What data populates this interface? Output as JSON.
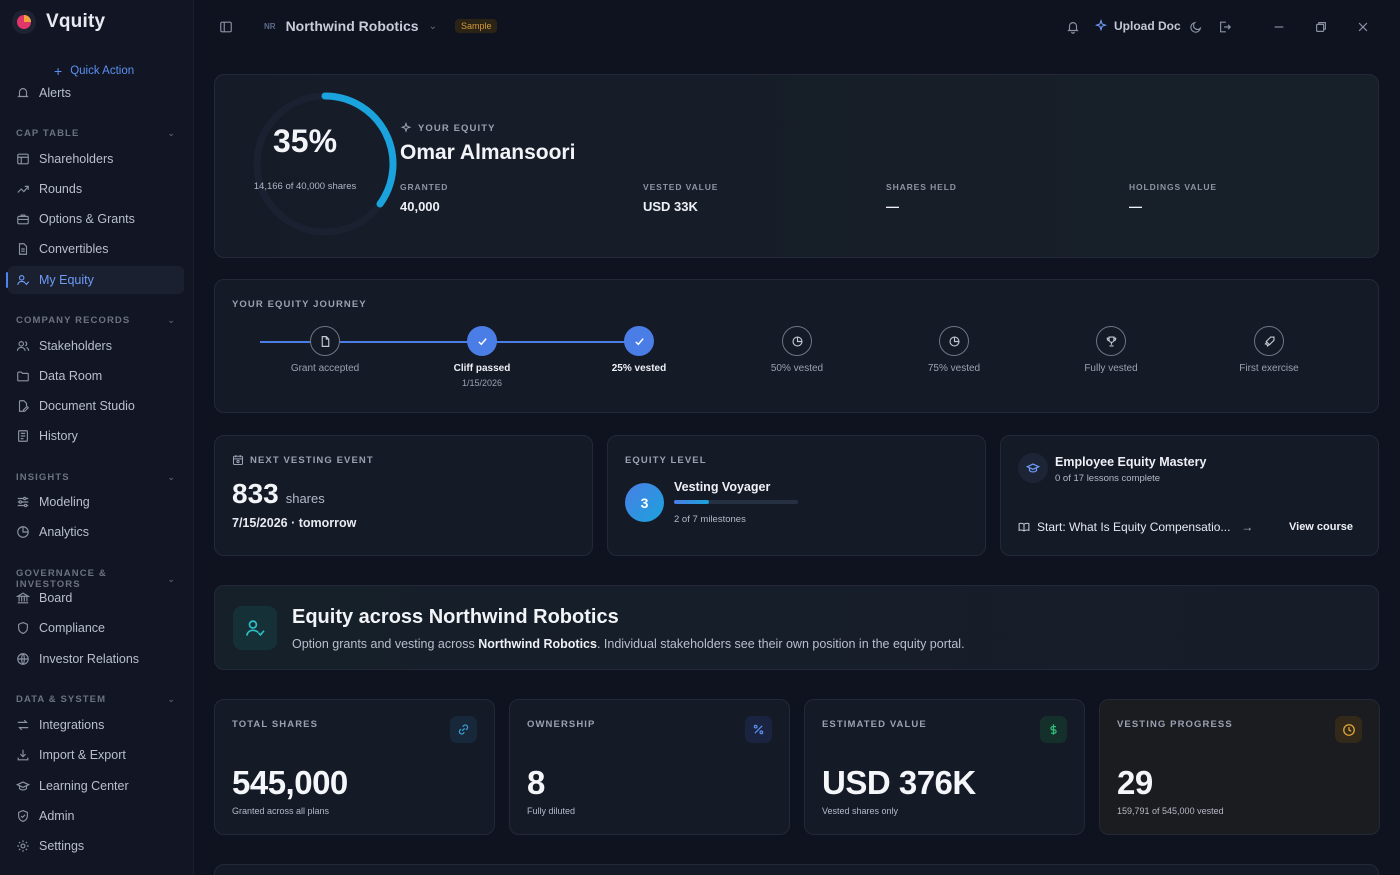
{
  "app": {
    "name": "Vquity",
    "quick_action": "Quick Action",
    "accent": "#4a7ee6"
  },
  "sidebar": {
    "partial_item": "Alerts",
    "sections": [
      {
        "title": "CAP TABLE",
        "items": [
          "Shareholders",
          "Rounds",
          "Options & Grants",
          "Convertibles",
          "My Equity"
        ]
      },
      {
        "title": "COMPANY RECORDS",
        "items": [
          "Stakeholders",
          "Data Room",
          "Document Studio",
          "History"
        ]
      },
      {
        "title": "INSIGHTS",
        "items": [
          "Modeling",
          "Analytics"
        ]
      },
      {
        "title": "GOVERNANCE & INVESTORS",
        "items": [
          "Board",
          "Compliance",
          "Investor Relations"
        ]
      },
      {
        "title": "DATA & SYSTEM",
        "items": [
          "Integrations",
          "Import & Export",
          "Learning Center",
          "Admin",
          "Settings"
        ]
      }
    ],
    "active_item": "My Equity"
  },
  "topbar": {
    "org_initials": "NR",
    "org_name": "Northwind Robotics",
    "sample_badge": "Sample",
    "upload_label": "Upload Doc"
  },
  "hero": {
    "percent_label": "35%",
    "percent_value": 0.35,
    "shares_sub": "14,166 of 40,000 shares",
    "tag": "YOUR EQUITY",
    "name": "Omar Almansoori",
    "stats": [
      {
        "label": "GRANTED",
        "value": "40,000"
      },
      {
        "label": "VESTED VALUE",
        "value": "USD 33K"
      },
      {
        "label": "SHARES HELD",
        "value": "—"
      },
      {
        "label": "HOLDINGS VALUE",
        "value": "—"
      }
    ]
  },
  "journey": {
    "title": "YOUR EQUITY JOURNEY",
    "steps": [
      {
        "label": "Grant accepted",
        "state": "pending",
        "icon": "document-icon",
        "date": ""
      },
      {
        "label": "Cliff passed",
        "state": "done",
        "icon": "check-icon",
        "date": "1/15/2026"
      },
      {
        "label": "25% vested",
        "state": "done",
        "icon": "check-icon",
        "date": ""
      },
      {
        "label": "50% vested",
        "state": "pending",
        "icon": "pie-icon",
        "date": ""
      },
      {
        "label": "75% vested",
        "state": "pending",
        "icon": "pie-icon",
        "date": ""
      },
      {
        "label": "Fully vested",
        "state": "pending",
        "icon": "trophy-icon",
        "date": ""
      },
      {
        "label": "First exercise",
        "state": "pending",
        "icon": "rocket-icon",
        "date": ""
      }
    ]
  },
  "next_vesting": {
    "title": "NEXT VESTING EVENT",
    "amount": "833",
    "unit": "shares",
    "date": "7/15/2026 · tomorrow"
  },
  "equity_level": {
    "title": "EQUITY LEVEL",
    "level": "3",
    "name": "Vesting Voyager",
    "progress": "2 of 7 milestones",
    "progress_fraction": 0.2857
  },
  "course": {
    "title": "Employee Equity Mastery",
    "sub": "0 of 17 lessons complete",
    "lesson": "Start: What Is Equity Compensatio...",
    "cta": "View course"
  },
  "banner": {
    "title": "Equity across Northwind Robotics",
    "desc_pre": "Option grants and vesting across ",
    "desc_bold": "Northwind Robotics",
    "desc_post": ". Individual stakeholders see their own position in the equity portal."
  },
  "stats": [
    {
      "title": "TOTAL SHARES",
      "value": "545,000",
      "sub": "Granted across all plans",
      "icon": "link-icon",
      "color": "#3aa0d8"
    },
    {
      "title": "OWNERSHIP",
      "value": "8",
      "sub": "Fully diluted",
      "icon": "percent-icon",
      "color": "#5b8ff0"
    },
    {
      "title": "ESTIMATED VALUE",
      "value": "USD 376K",
      "sub": "Vested shares only",
      "icon": "dollar-icon",
      "color": "#2fbf7a"
    },
    {
      "title": "VESTING PROGRESS",
      "value": "29",
      "sub": "159,791 of 545,000 vested",
      "icon": "clock-icon",
      "color": "#e0a43a"
    }
  ]
}
